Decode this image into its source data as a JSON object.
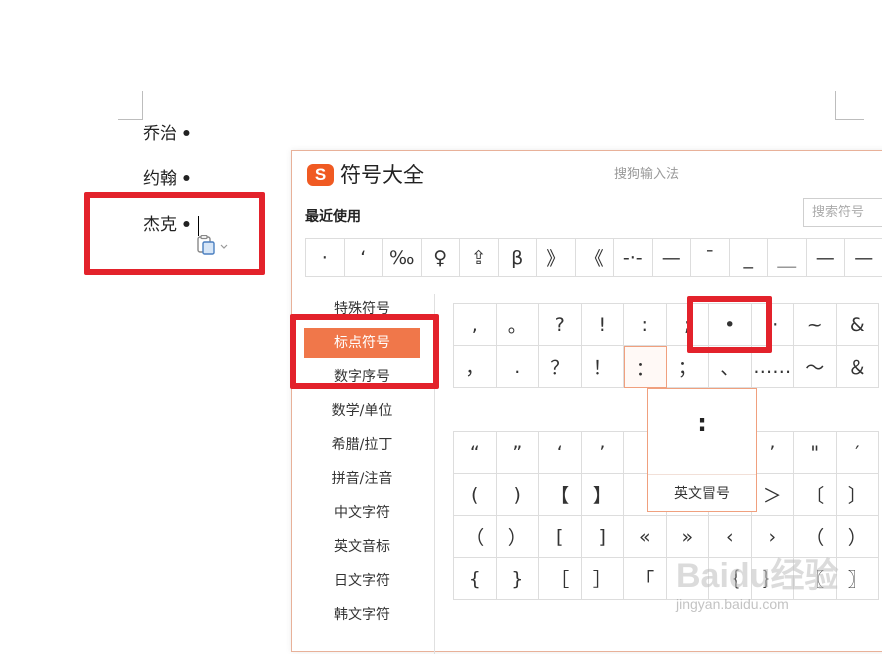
{
  "document": {
    "lines": [
      "乔治",
      "约翰",
      "杰克"
    ],
    "bullet": "•"
  },
  "panel": {
    "logo": "S",
    "title": "符号大全",
    "brand": "搜狗输入法",
    "recent_label": "最近使用",
    "search_placeholder": "搜索符号",
    "recent": [
      "·",
      "‘",
      "‰",
      "♀",
      "⇪",
      "β",
      "》",
      "《",
      "-·-",
      "—",
      "¯",
      "_",
      "＿",
      "—",
      "—"
    ],
    "categories": [
      "特殊符号",
      "标点符号",
      "数字序号",
      "数学/单位",
      "希腊/拉丁",
      "拼音/注音",
      "中文字符",
      "英文音标",
      "日文字符",
      "韩文字符"
    ],
    "active_category": "标点符号",
    "grid_top": [
      [
        ",",
        "。",
        "?",
        "!",
        ":",
        ";",
        "•",
        "··",
        "~",
        "&"
      ],
      [
        "，",
        ".",
        "？",
        "！",
        "：",
        "；",
        "、",
        "……",
        "～",
        "＆"
      ]
    ],
    "grid_bottom": [
      [
        "“",
        "”",
        "‘",
        "’",
        "",
        "",
        "",
        "’",
        "\"",
        "′"
      ],
      [
        "(",
        ")",
        "【",
        "】",
        "",
        "",
        "",
        "＞",
        "〔",
        "〕"
      ],
      [
        "（",
        "）",
        "[",
        "]",
        "«",
        "»",
        "‹",
        "›",
        "（",
        "）"
      ],
      [
        "{",
        "}",
        "［",
        "］",
        "「",
        "",
        "｛",
        "｝",
        "〖",
        "〗"
      ]
    ],
    "tooltip": {
      "symbol": ":",
      "name": "英文冒号"
    }
  },
  "watermark": {
    "brand": "Baidu经验",
    "url": "jingyan.baidu.com"
  },
  "colors": {
    "accent": "#f0774a",
    "highlight": "#e3222b"
  }
}
